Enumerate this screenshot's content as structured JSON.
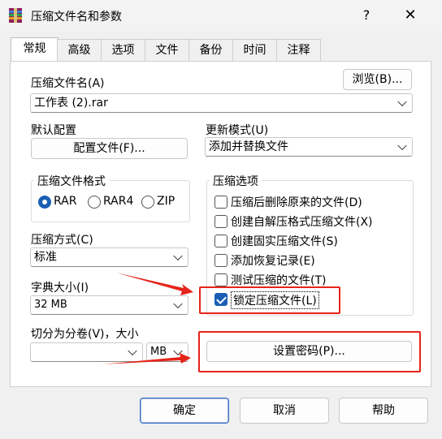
{
  "window": {
    "title": "压缩文件名和参数",
    "help": "?",
    "close": "✕"
  },
  "tabs": [
    {
      "label": "常规",
      "active": true
    },
    {
      "label": "高级"
    },
    {
      "label": "选项"
    },
    {
      "label": "文件"
    },
    {
      "label": "备份"
    },
    {
      "label": "时间"
    },
    {
      "label": "注释"
    }
  ],
  "archive_name": {
    "label": "压缩文件名(A)",
    "browse": "浏览(B)...",
    "value": "工作表 (2).rar"
  },
  "profile": {
    "label": "默认配置",
    "button": "配置文件(F)..."
  },
  "update_mode": {
    "label": "更新模式(U)",
    "value": "添加并替换文件"
  },
  "format": {
    "title": "压缩文件格式",
    "options": [
      "RAR",
      "RAR4",
      "ZIP"
    ],
    "selected": "RAR"
  },
  "options_group": {
    "title": "压缩选项",
    "items": [
      {
        "label": "压缩后删除原来的文件(D)",
        "checked": false
      },
      {
        "label": "创建自解压格式压缩文件(X)",
        "checked": false
      },
      {
        "label": "创建固实压缩文件(S)",
        "checked": false
      },
      {
        "label": "添加恢复记录(E)",
        "checked": false
      },
      {
        "label": "测试压缩的文件(T)",
        "checked": false
      },
      {
        "label": "锁定压缩文件(L)",
        "checked": true
      }
    ]
  },
  "method": {
    "label": "压缩方式(C)",
    "value": "标准"
  },
  "dict": {
    "label": "字典大小(I)",
    "value": "32 MB"
  },
  "split": {
    "label": "切分为分卷(V)，大小",
    "value": "",
    "unit": "MB"
  },
  "password_button": "设置密码(P)...",
  "footer": {
    "ok": "确定",
    "cancel": "取消",
    "help": "帮助"
  },
  "colors": {
    "accent": "#1a5fb4",
    "annotation": "#e6241a"
  }
}
